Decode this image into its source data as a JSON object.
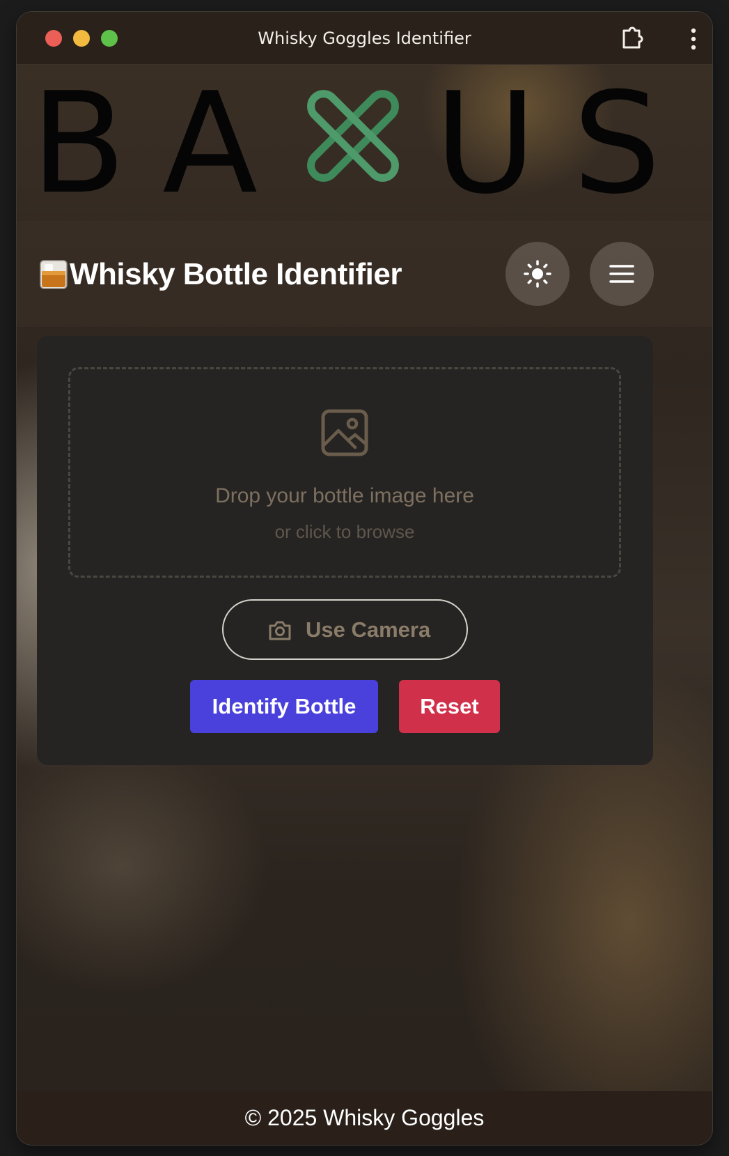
{
  "window": {
    "title": "Whisky Goggles Identifier"
  },
  "logo": {
    "text_left": "BA",
    "text_right": "US"
  },
  "header": {
    "title": "Whisky Bottle Identifier"
  },
  "dropzone": {
    "title": "Drop your bottle image here",
    "subtitle": "or click to browse"
  },
  "actions": {
    "camera_label": "Use Camera",
    "identify_label": "Identify Bottle",
    "reset_label": "Reset"
  },
  "footer": {
    "text": "© 2025 Whisky Goggles"
  },
  "colors": {
    "accent_primary": "#4a41dc",
    "accent_danger": "#d0304a",
    "logo_green": "#3f8a5a",
    "card_bg": "#252422"
  },
  "icons": {
    "window_controls": [
      "close-icon",
      "minimize-icon",
      "maximize-icon"
    ],
    "toolbar": [
      "extension-icon",
      "more-vertical-icon"
    ],
    "header": [
      "whisky-glass-emoji-icon",
      "sun-icon",
      "hamburger-menu-icon"
    ],
    "card": [
      "image-icon",
      "camera-icon"
    ]
  }
}
